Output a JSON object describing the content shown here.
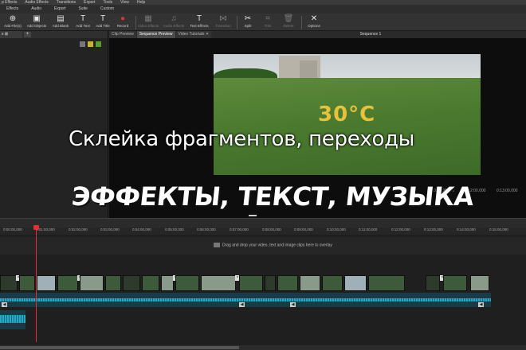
{
  "menu": [
    "p Effects",
    "Audio Effects",
    "Transitions",
    "Export",
    "Tools",
    "View",
    "Help"
  ],
  "ribbon_tabs": [
    "Effects",
    "Audio",
    "Export",
    "Suite",
    "Custom"
  ],
  "toolbar": {
    "add_files": "Add File(s)",
    "add_objects": "Add Objects",
    "add_blank": "Add Blank",
    "add_text": "Add Text",
    "add_title": "Add Title",
    "record": "Record",
    "video_effects": "Video Effects",
    "audio_effects": "Audio Effects",
    "text_effects": "Text Effects",
    "transition": "Transition",
    "split": "Split",
    "trim": "Trim",
    "delete": "Delete",
    "options": "Options"
  },
  "left_panel": {
    "tab": "s ⊠",
    "add": "+"
  },
  "preview": {
    "tabs": [
      "Clip Preview",
      "Sequence Preview",
      "Video Tutorials ✕"
    ],
    "active_tab": 1,
    "sequence_title": "Sequence 1",
    "temperature": "30°C",
    "ruler": [
      "0:11:00,000",
      "0:12:00,000",
      "0:13:00,000"
    ]
  },
  "captions": {
    "line1": "Склейка фрагментов, переходы",
    "line2": "ЭФФЕКТЫ, ТЕКСТ, МУЗЫКА"
  },
  "timeline": {
    "ruler_ticks": [
      "0:00:00,000",
      "0:01:00,000",
      "0:02:00,000",
      "0:03:00,000",
      "0:04:00,000",
      "0:05:00,000",
      "0:06:00,000",
      "0:07:00,000",
      "0:08:00,000",
      "0:09:00,000",
      "0:10:00,000",
      "0:11:00,000",
      "0:12:00,000",
      "0:13:00,000",
      "0:14:00,000",
      "0:15:00,000",
      "0:16:00,000"
    ],
    "overlay_hint": "Drag and drop your video, text and image clips here to overlay"
  }
}
